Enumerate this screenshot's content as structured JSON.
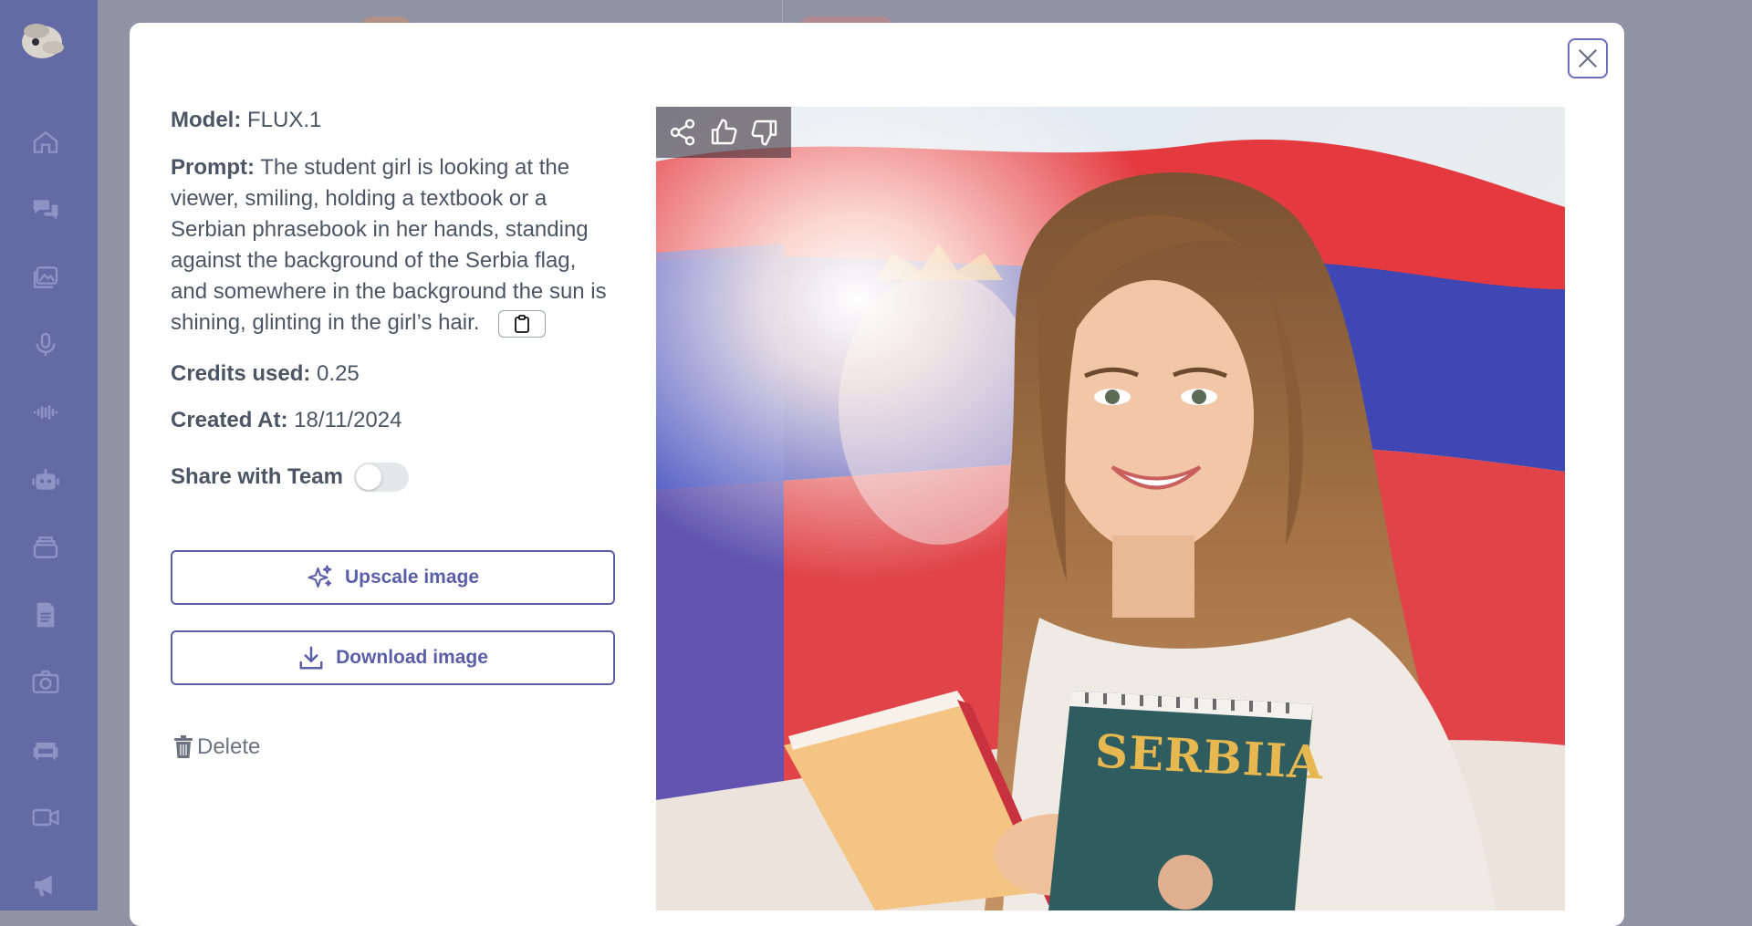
{
  "sidebar": {
    "items": [
      {
        "name": "home",
        "icon": "home-icon"
      },
      {
        "name": "chat",
        "icon": "chat-bubbles-icon"
      },
      {
        "name": "images",
        "icon": "image-gallery-icon"
      },
      {
        "name": "microphone",
        "icon": "microphone-icon"
      },
      {
        "name": "audio",
        "icon": "sound-wave-icon"
      },
      {
        "name": "bot",
        "icon": "robot-icon"
      },
      {
        "name": "stack",
        "icon": "layers-icon"
      },
      {
        "name": "document",
        "icon": "document-icon"
      },
      {
        "name": "camera",
        "icon": "camera-icon"
      },
      {
        "name": "sofa",
        "icon": "sofa-icon"
      },
      {
        "name": "video",
        "icon": "video-camera-icon"
      },
      {
        "name": "announcements",
        "icon": "megaphone-icon"
      }
    ]
  },
  "details": {
    "model_label": "Model:",
    "model_value": "FLUX.1",
    "prompt_label": "Prompt:",
    "prompt_value": "The student girl is looking at the viewer, smiling, holding a textbook or a Serbian phrasebook in her hands, standing against the background of the Serbia flag, and somewhere in the background the sun is shining, glinting in the girl’s hair.",
    "credits_label": "Credits used:",
    "credits_value": "0.25",
    "created_label": "Created At:",
    "created_value": "18/11/2024",
    "share_label": "Share with Team",
    "share_enabled": false
  },
  "actions": {
    "upscale_label": "Upscale image",
    "download_label": "Download image",
    "delete_label": "Delete"
  },
  "image": {
    "book_title": "SERBIIA"
  },
  "colors": {
    "accent": "#5b5fa8",
    "sidebar": "#646aa4",
    "text": "#4b5563"
  }
}
